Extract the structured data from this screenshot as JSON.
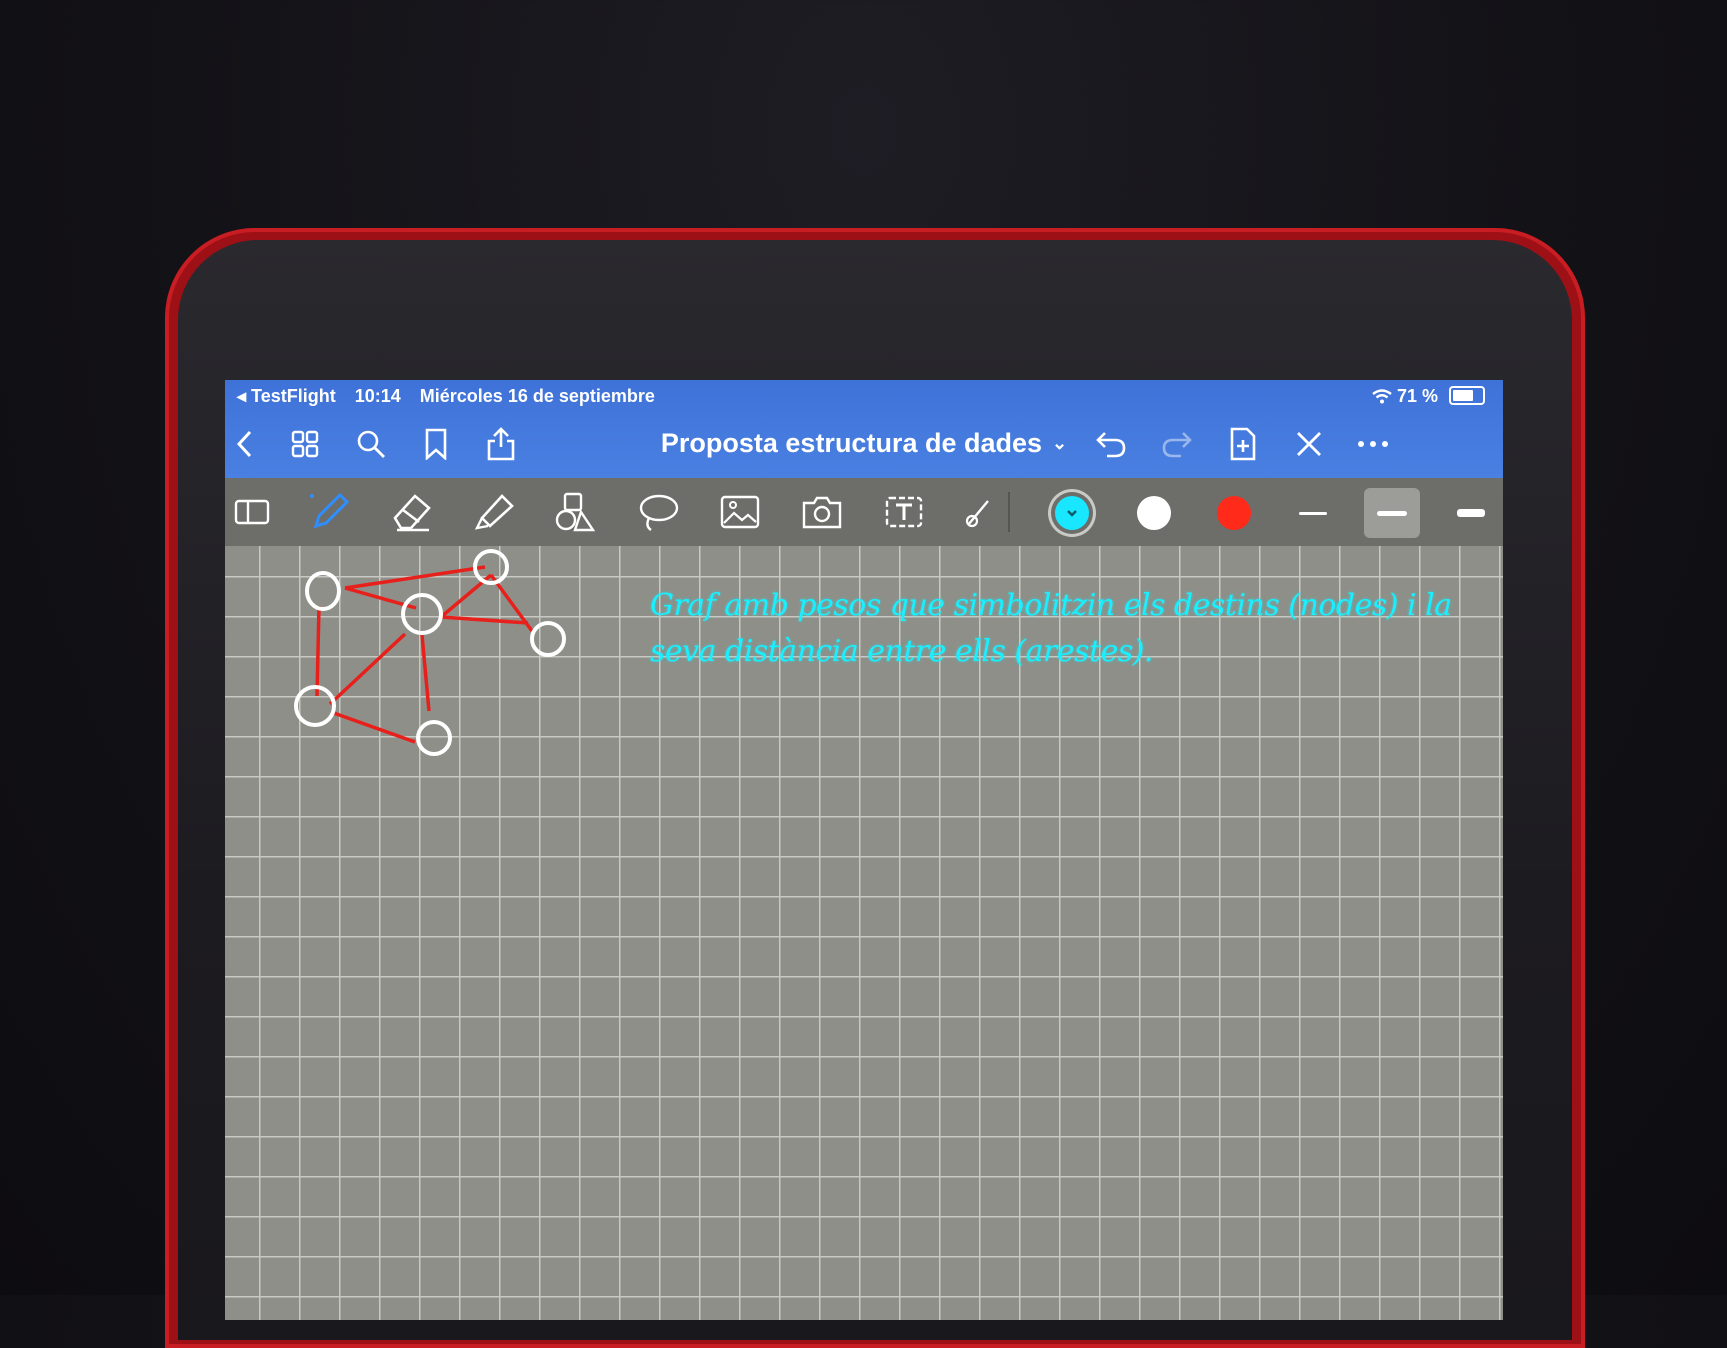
{
  "status_bar": {
    "back_app": "◂ TestFlight",
    "time": "10:14",
    "date": "Miércoles 16 de septiembre",
    "battery": "71 %"
  },
  "nav_bar": {
    "title": "Proposta estructura de dades",
    "icons": [
      "chevron-left-icon",
      "grid-icon",
      "search-icon",
      "bookmark-icon",
      "share-icon",
      "undo-icon",
      "redo-icon",
      "add-page-icon",
      "close-pen-icon",
      "more-icon"
    ]
  },
  "toolbar": {
    "tools": [
      "page-panel-icon",
      "pen-icon",
      "eraser-icon",
      "highlighter-icon",
      "shapes-icon",
      "lasso-icon",
      "image-icon",
      "camera-icon",
      "text-icon",
      "laser-icon"
    ],
    "colors": [
      "#19e6ff",
      "#ffffff",
      "#ff2a1a"
    ],
    "selected_color": "#19e6ff",
    "stroke_widths": [
      "thin",
      "medium",
      "thick"
    ],
    "selected_stroke": "medium"
  },
  "note": {
    "line1": "Graf amb pesos que simbolitzin els destins (nodes) i la",
    "line2": "seva distància entre ells (arestes).",
    "ink_color": "#19f0ff"
  },
  "graph_sketch": {
    "ink_edges": "#e8201c",
    "ink_nodes": "#ffffff",
    "nodes": 6,
    "edges": 8
  }
}
